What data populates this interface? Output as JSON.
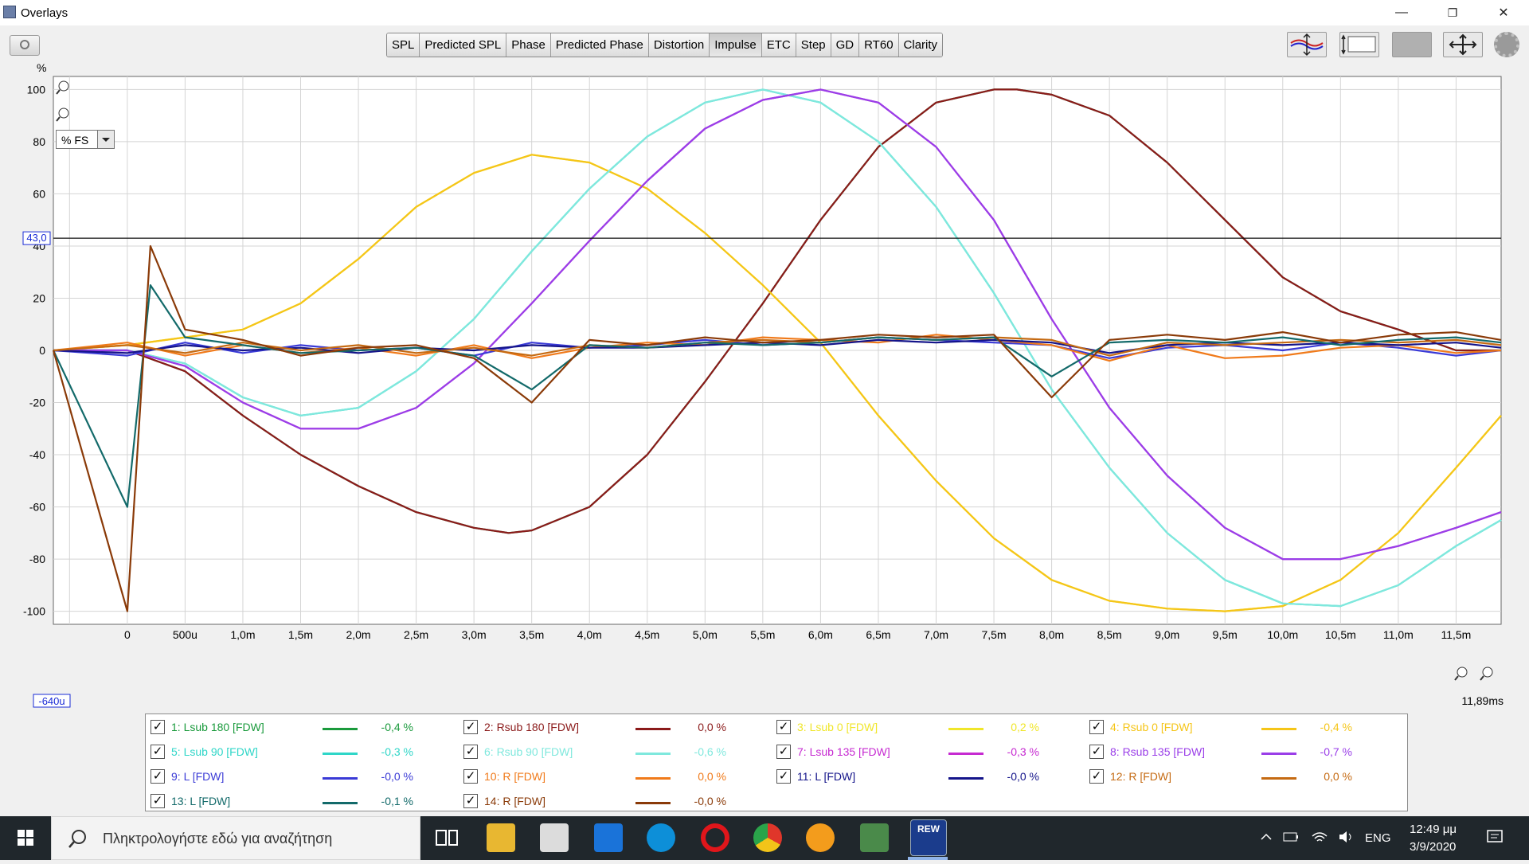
{
  "window": {
    "title": "Overlays",
    "minimize": "—",
    "restore": "❐",
    "close": "✕"
  },
  "toolbar": {
    "tabs": [
      "SPL",
      "Predicted SPL",
      "Phase",
      "Predicted Phase",
      "Distortion",
      "Impulse",
      "ETC",
      "Step",
      "GD",
      "RT60",
      "Clarity"
    ],
    "active_tab": "Impulse"
  },
  "graph": {
    "y_unit": "%",
    "scale_select": "% FS",
    "y_tick_labels": [
      "100",
      "80",
      "60",
      "40",
      "20",
      "0",
      "-20",
      "-40",
      "-60",
      "-80",
      "-100"
    ],
    "x_tick_labels": [
      "0",
      "500u",
      "1,0m",
      "1,5m",
      "2,0m",
      "2,5m",
      "3,0m",
      "3,5m",
      "4,0m",
      "4,5m",
      "5,0m",
      "5,5m",
      "6,0m",
      "6,5m",
      "7,0m",
      "7,5m",
      "8,0m",
      "8,5m",
      "9,0m",
      "9,5m",
      "10,0m",
      "10,5m",
      "11,0m",
      "11,5m"
    ],
    "x_start_label": "-640u",
    "x_end_label": "11,89ms",
    "cursor_value_label": "43,0"
  },
  "chart_data": {
    "type": "line",
    "xlabel": "",
    "ylabel": "%",
    "xlim": [
      -0.64,
      11.89
    ],
    "ylim": [
      -105,
      105
    ],
    "x_unit": "ms",
    "cursor_y": 43.0,
    "series": [
      {
        "name": "1: Lsub 180 [FDW]",
        "color": "#1a9a3c",
        "x": [
          -0.64,
          0,
          0.5,
          1,
          1.5,
          2,
          2.5,
          3,
          3.3,
          3.5,
          4,
          4.5,
          5,
          5.5,
          6,
          6.5,
          7,
          7.5,
          7.7,
          8,
          8.5,
          9,
          9.5,
          10,
          10.5,
          11,
          11.5,
          11.89
        ],
        "values": [
          0,
          0,
          -8,
          -25,
          -40,
          -52,
          -62,
          -68,
          -70,
          -69,
          -60,
          -40,
          -12,
          18,
          50,
          78,
          95,
          100,
          100,
          98,
          90,
          72,
          50,
          28,
          15,
          8,
          0,
          0
        ]
      },
      {
        "name": "2: Rsub 180 [FDW]",
        "color": "#8b1a1a",
        "x": [
          -0.64,
          0,
          0.5,
          1,
          1.5,
          2,
          2.5,
          3,
          3.3,
          3.5,
          4,
          4.5,
          5,
          5.5,
          6,
          6.5,
          7,
          7.5,
          7.7,
          8,
          8.5,
          9,
          9.5,
          10,
          10.5,
          11,
          11.5,
          11.89
        ],
        "values": [
          0,
          0,
          -8,
          -25,
          -40,
          -52,
          -62,
          -68,
          -70,
          -69,
          -60,
          -40,
          -12,
          18,
          50,
          78,
          95,
          100,
          100,
          98,
          90,
          72,
          50,
          28,
          15,
          8,
          0,
          0
        ]
      },
      {
        "name": "3: Lsub 0 [FDW]",
        "color": "#f0e62a",
        "x": [
          -0.64,
          0,
          0.5,
          1,
          1.5,
          2,
          2.5,
          3,
          3.5,
          4,
          4.5,
          5,
          5.5,
          6,
          6.5,
          7,
          7.5,
          8,
          8.5,
          9,
          9.5,
          10,
          10.5,
          11,
          11.5,
          11.89
        ],
        "values": [
          0,
          2,
          5,
          8,
          18,
          35,
          55,
          68,
          75,
          72,
          62,
          45,
          25,
          3,
          -25,
          -50,
          -72,
          -88,
          -96,
          -99,
          -100,
          -98,
          -88,
          -70,
          -45,
          -25
        ]
      },
      {
        "name": "4: Rsub 0 [FDW]",
        "color": "#f5c518",
        "x": [
          -0.64,
          0,
          0.5,
          1,
          1.5,
          2,
          2.5,
          3,
          3.5,
          4,
          4.5,
          5,
          5.5,
          6,
          6.5,
          7,
          7.5,
          8,
          8.5,
          9,
          9.5,
          10,
          10.5,
          11,
          11.5,
          11.89
        ],
        "values": [
          0,
          2,
          5,
          8,
          18,
          35,
          55,
          68,
          75,
          72,
          62,
          45,
          25,
          3,
          -25,
          -50,
          -72,
          -88,
          -96,
          -99,
          -100,
          -98,
          -88,
          -70,
          -45,
          -25
        ]
      },
      {
        "name": "5: Lsub 90 [FDW]",
        "color": "#2fd6c8",
        "x": [
          -0.64,
          0,
          0.5,
          1,
          1.5,
          2,
          2.5,
          3,
          3.5,
          4,
          4.5,
          5,
          5.5,
          6,
          6.5,
          7,
          7.5,
          8,
          8.5,
          9,
          9.5,
          10,
          10.5,
          11,
          11.5,
          11.89
        ],
        "values": [
          0,
          0,
          -5,
          -18,
          -25,
          -22,
          -8,
          12,
          38,
          62,
          82,
          95,
          100,
          95,
          80,
          55,
          22,
          -15,
          -45,
          -70,
          -88,
          -97,
          -98,
          -90,
          -75,
          -65
        ]
      },
      {
        "name": "6: Rsub 90 [FDW]",
        "color": "#7fe8dd",
        "x": [
          -0.64,
          0,
          0.5,
          1,
          1.5,
          2,
          2.5,
          3,
          3.5,
          4,
          4.5,
          5,
          5.5,
          6,
          6.5,
          7,
          7.5,
          8,
          8.5,
          9,
          9.5,
          10,
          10.5,
          11,
          11.5,
          11.89
        ],
        "values": [
          0,
          0,
          -5,
          -18,
          -25,
          -22,
          -8,
          12,
          38,
          62,
          82,
          95,
          100,
          95,
          80,
          55,
          22,
          -15,
          -45,
          -70,
          -88,
          -97,
          -98,
          -90,
          -75,
          -65
        ]
      },
      {
        "name": "7: Lsub 135 [FDW]",
        "color": "#c62ad1",
        "x": [
          -0.64,
          0,
          0.5,
          1,
          1.5,
          2,
          2.5,
          3,
          3.5,
          4,
          4.5,
          5,
          5.5,
          6,
          6.5,
          7,
          7.5,
          8,
          8.5,
          9,
          9.5,
          10,
          10.5,
          11,
          11.5,
          11.89
        ],
        "values": [
          0,
          0,
          -6,
          -20,
          -30,
          -30,
          -22,
          -5,
          18,
          42,
          65,
          85,
          96,
          100,
          95,
          78,
          50,
          12,
          -22,
          -48,
          -68,
          -80,
          -80,
          -75,
          -68,
          -62
        ]
      },
      {
        "name": "8: Rsub 135 [FDW]",
        "color": "#9a3ee8",
        "x": [
          -0.64,
          0,
          0.5,
          1,
          1.5,
          2,
          2.5,
          3,
          3.5,
          4,
          4.5,
          5,
          5.5,
          6,
          6.5,
          7,
          7.5,
          8,
          8.5,
          9,
          9.5,
          10,
          10.5,
          11,
          11.5,
          11.89
        ],
        "values": [
          0,
          0,
          -6,
          -20,
          -30,
          -30,
          -22,
          -5,
          18,
          42,
          65,
          85,
          96,
          100,
          95,
          78,
          50,
          12,
          -22,
          -48,
          -68,
          -80,
          -80,
          -75,
          -68,
          -62
        ]
      },
      {
        "name": "9: L [FDW]",
        "color": "#3a3ad6",
        "x": [
          -0.64,
          0,
          0.5,
          1,
          1.5,
          2,
          2.5,
          3,
          3.5,
          4,
          4.5,
          5,
          5.5,
          6,
          6.5,
          7,
          7.5,
          8,
          8.5,
          9,
          9.5,
          10,
          10.5,
          11,
          11.5,
          11.89
        ],
        "values": [
          0,
          -2,
          3,
          -1,
          2,
          0,
          1,
          -2,
          3,
          1,
          2,
          4,
          2,
          3,
          5,
          4,
          3,
          2,
          -3,
          1,
          2,
          0,
          3,
          1,
          -2,
          0
        ]
      },
      {
        "name": "10: R [FDW]",
        "color": "#f07a1a",
        "x": [
          -0.64,
          0,
          0.5,
          1,
          1.5,
          2,
          2.5,
          3,
          3.5,
          4,
          4.5,
          5,
          5.5,
          6,
          6.5,
          7,
          7.5,
          8,
          8.5,
          9,
          9.5,
          10,
          10.5,
          11,
          11.5,
          11.89
        ],
        "values": [
          0,
          3,
          -2,
          2,
          -1,
          1,
          -2,
          2,
          -3,
          1,
          3,
          2,
          5,
          4,
          3,
          6,
          4,
          2,
          -4,
          2,
          -3,
          -2,
          1,
          2,
          -1,
          0
        ]
      },
      {
        "name": "11: L [FDW]",
        "color": "#14148a",
        "x": [
          -0.64,
          0,
          0.5,
          1,
          1.5,
          2,
          2.5,
          3,
          3.5,
          4,
          4.5,
          5,
          5.5,
          6,
          6.5,
          7,
          7.5,
          8,
          8.5,
          9,
          9.5,
          10,
          10.5,
          11,
          11.5,
          11.89
        ],
        "values": [
          0,
          -1,
          2,
          0,
          1,
          -1,
          1,
          0,
          2,
          1,
          1,
          2,
          3,
          2,
          4,
          3,
          4,
          3,
          -1,
          2,
          3,
          2,
          3,
          2,
          3,
          1
        ]
      },
      {
        "name": "12: R [FDW]",
        "color": "#c56a12",
        "x": [
          -0.64,
          0,
          0.5,
          1,
          1.5,
          2,
          2.5,
          3,
          3.5,
          4,
          4.5,
          5,
          5.5,
          6,
          6.5,
          7,
          7.5,
          8,
          8.5,
          9,
          9.5,
          10,
          10.5,
          11,
          11.5,
          11.89
        ],
        "values": [
          0,
          2,
          -1,
          3,
          0,
          2,
          -1,
          1,
          -2,
          2,
          1,
          3,
          4,
          3,
          5,
          4,
          5,
          4,
          -2,
          3,
          2,
          3,
          4,
          3,
          4,
          2
        ]
      },
      {
        "name": "13: L [FDW]",
        "color": "#136a6a",
        "x": [
          -0.64,
          0,
          0.2,
          0.5,
          1,
          1.5,
          2,
          2.5,
          3,
          3.5,
          4,
          4.5,
          5,
          5.5,
          6,
          6.5,
          7,
          7.5,
          8,
          8.5,
          9,
          9.5,
          10,
          10.5,
          11,
          11.5,
          11.89
        ],
        "values": [
          0,
          -60,
          25,
          5,
          2,
          -1,
          0,
          1,
          -2,
          -15,
          2,
          1,
          3,
          2,
          3,
          5,
          4,
          5,
          -10,
          3,
          4,
          3,
          5,
          2,
          4,
          5,
          3
        ]
      },
      {
        "name": "14: R [FDW]",
        "color": "#8a3a08",
        "x": [
          -0.64,
          0,
          0.2,
          0.5,
          1,
          1.5,
          2,
          2.5,
          3,
          3.5,
          4,
          4.5,
          5,
          5.5,
          6,
          6.5,
          7,
          7.5,
          8,
          8.5,
          9,
          9.5,
          10,
          10.5,
          11,
          11.5,
          11.89
        ],
        "values": [
          0,
          -100,
          40,
          8,
          4,
          -2,
          1,
          2,
          -3,
          -20,
          4,
          2,
          5,
          3,
          4,
          6,
          5,
          6,
          -18,
          4,
          6,
          4,
          7,
          3,
          6,
          7,
          4
        ]
      }
    ]
  },
  "legend": {
    "items": [
      {
        "label": "1: Lsub 180 [FDW]",
        "value": "-0,4 %",
        "color": "#1a9a3c"
      },
      {
        "label": "2: Rsub 180 [FDW]",
        "value": "0,0 %",
        "color": "#8b1a1a"
      },
      {
        "label": "3: Lsub 0 [FDW]",
        "value": "0,2 %",
        "color": "#f0e62a"
      },
      {
        "label": "4: Rsub 0 [FDW]",
        "value": "-0,4 %",
        "color": "#f5c518"
      },
      {
        "label": "5: Lsub 90 [FDW]",
        "value": "-0,3 %",
        "color": "#2fd6c8"
      },
      {
        "label": "6: Rsub 90 [FDW]",
        "value": "-0,6 %",
        "color": "#7fe8dd"
      },
      {
        "label": "7: Lsub 135 [FDW]",
        "value": "-0,3 %",
        "color": "#c62ad1"
      },
      {
        "label": "8: Rsub 135 [FDW]",
        "value": "-0,7 %",
        "color": "#9a3ee8"
      },
      {
        "label": "9: L [FDW]",
        "value": "-0,0 %",
        "color": "#3a3ad6"
      },
      {
        "label": "10: R [FDW]",
        "value": "0,0 %",
        "color": "#f07a1a"
      },
      {
        "label": "11: L [FDW]",
        "value": "-0,0 %",
        "color": "#14148a"
      },
      {
        "label": "12: R [FDW]",
        "value": "0,0 %",
        "color": "#c56a12"
      },
      {
        "label": "13: L [FDW]",
        "value": "-0,1 %",
        "color": "#136a6a"
      },
      {
        "label": "14: R [FDW]",
        "value": "-0,0 %",
        "color": "#8a3a08"
      }
    ]
  },
  "taskbar": {
    "search_placeholder": "Πληκτρολογήστε εδώ για αναζήτηση",
    "language": "ENG",
    "time": "12:49 μμ",
    "date": "3/9/2020",
    "rew_label": "REW"
  }
}
